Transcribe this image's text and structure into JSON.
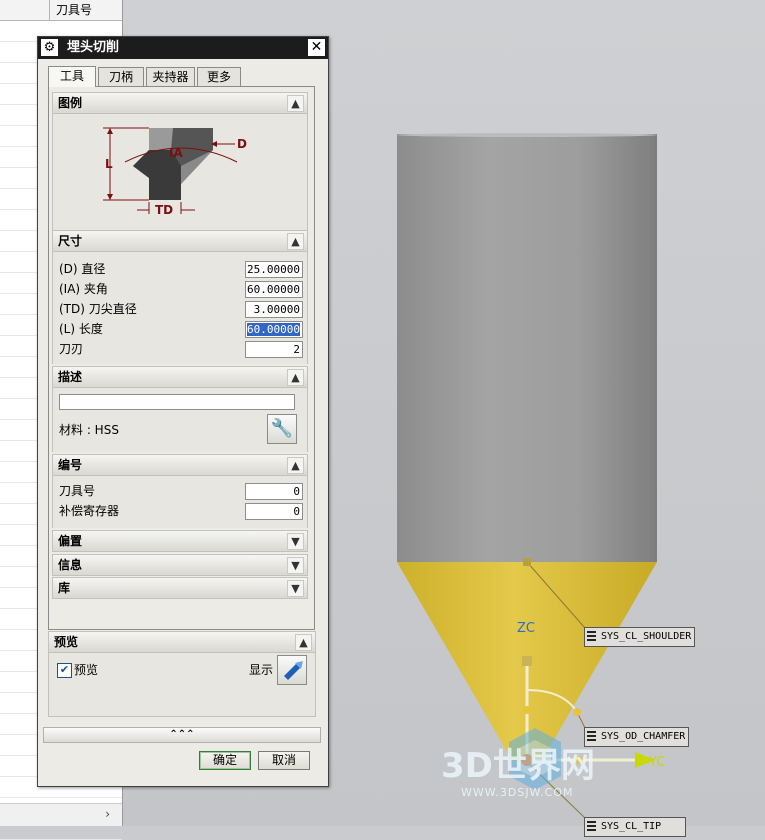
{
  "left_panel": {
    "column_header": "刀具号",
    "scroll_arrow": "›"
  },
  "dialog": {
    "title": "埋头切削",
    "close_glyph": "✕",
    "tabs": [
      {
        "label": "工具"
      },
      {
        "label": "刀柄"
      },
      {
        "label": "夹持器"
      },
      {
        "label": "更多"
      }
    ],
    "active_tab": "工具",
    "sections": {
      "legend": {
        "label": "图例",
        "diagram_labels": {
          "ia": "IA",
          "d": "D",
          "l": "L",
          "td": "TD"
        }
      },
      "dimensions": {
        "label": "尺寸",
        "fields": [
          {
            "label": "(D) 直径",
            "value": "25.00000"
          },
          {
            "label": "(IA) 夹角",
            "value": "60.00000"
          },
          {
            "label": "(TD) 刀尖直径",
            "value": "3.00000"
          },
          {
            "label": "(L) 长度",
            "value": "60.00000"
          },
          {
            "label": "刀刃",
            "value": "2"
          }
        ]
      },
      "description": {
        "label": "描述",
        "text_value": "",
        "material_label": "材料 : HSS"
      },
      "numbering": {
        "label": "编号",
        "fields": [
          {
            "label": "刀具号",
            "value": "0"
          },
          {
            "label": "补偿寄存器",
            "value": "0"
          }
        ]
      },
      "offset": {
        "label": "偏置"
      },
      "info": {
        "label": "信息"
      },
      "library": {
        "label": "库"
      }
    },
    "preview": {
      "label": "预览",
      "checkbox_label": "预览",
      "checked": true,
      "show_label": "显示"
    },
    "more_glyph": "⌃⌃⌃",
    "ok_label": "确定",
    "cancel_label": "取消"
  },
  "viewport": {
    "axis_zc": "ZC",
    "axis_yc": "YC",
    "tags": [
      "SYS_CL_SHOULDER",
      "SYS_OD_CHAMFER",
      "SYS_CL_TIP"
    ],
    "colors": {
      "body": "#9a9a9a",
      "tip": "#dcc03a",
      "axis_z": "#2a6fd0",
      "axis_y": "#c8d800"
    },
    "watermark_logo": "3D世界网",
    "watermark_url": "WWW.3DSJW.COM"
  }
}
